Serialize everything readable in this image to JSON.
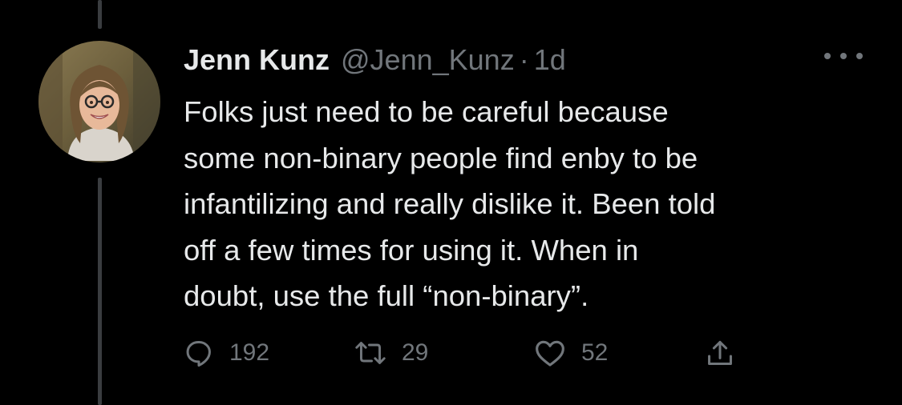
{
  "tweet": {
    "author_name": "Jenn Kunz",
    "handle": "@Jenn_Kunz",
    "separator": "·",
    "timestamp": "1d",
    "text": "Folks just need to be careful because\nsome non-binary people find enby to be\ninfantilizing and really dislike it. Been told\noff a few times for using it. When in\ndoubt, use the full “non-binary”.",
    "reply_count": "192",
    "retweet_count": "29",
    "like_count": "52"
  },
  "icons": {
    "reply": "speech-bubble-icon",
    "retweet": "retweet-arrows-icon",
    "like": "heart-outline-icon",
    "share": "share-upload-icon",
    "more": "more-dots-icon"
  },
  "colors": {
    "background": "#000000",
    "primary_text": "#e7e9ea",
    "secondary_text": "#71767b",
    "thread_line": "#3a3d40"
  }
}
